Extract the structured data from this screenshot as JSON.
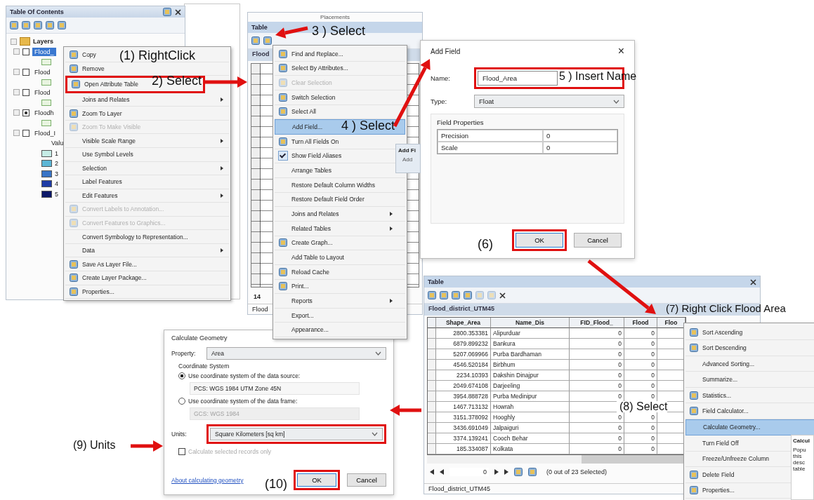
{
  "annotations": [
    "(1) RightClick",
    "2) Select",
    "3 ) Select",
    "4 ) Select",
    "5 ) Insert Name",
    "(6)",
    "(7) Right Click Flood Area",
    "(8) Select",
    "(9) Units",
    "(10)"
  ],
  "toc": {
    "title": "Table Of Contents",
    "root": "Layers",
    "layers": [
      {
        "label": "Flood_",
        "checked": false,
        "selected": true
      },
      {
        "label": "Flood",
        "checked": false,
        "selected": false
      },
      {
        "label": "Flood",
        "checked": false,
        "selected": false
      },
      {
        "label": "Floodh",
        "checked": true,
        "selected": false
      },
      {
        "label": "Flood_I",
        "checked": false,
        "selected": false,
        "legend_heading": "Valu",
        "legend": [
          {
            "label": "1",
            "color": "#c6ece6"
          },
          {
            "label": "2",
            "color": "#5cb6d6"
          },
          {
            "label": "3",
            "color": "#3a74c6"
          },
          {
            "label": "4",
            "color": "#1f3ca6"
          },
          {
            "label": "5",
            "color": "#0b1868"
          }
        ]
      }
    ]
  },
  "layer_menu": {
    "items": [
      {
        "label": "Copy",
        "icon": true,
        "disabled": false,
        "submenu": false,
        "outlined": false
      },
      {
        "label": "Remove",
        "icon": true,
        "disabled": false,
        "submenu": false,
        "outlined": false
      },
      {
        "label": "Open Attribute Table",
        "icon": true,
        "disabled": false,
        "submenu": false,
        "outlined": true
      },
      {
        "label": "Joins and Relates",
        "icon": false,
        "disabled": false,
        "submenu": true,
        "outlined": false
      },
      {
        "label": "Zoom To Layer",
        "icon": true,
        "disabled": false,
        "submenu": false,
        "outlined": false
      },
      {
        "label": "Zoom To Make Visible",
        "icon": true,
        "disabled": true,
        "submenu": false,
        "outlined": false
      },
      {
        "label": "Visible Scale Range",
        "icon": false,
        "disabled": false,
        "submenu": true,
        "outlined": false
      },
      {
        "label": "Use Symbol Levels",
        "icon": false,
        "disabled": false,
        "submenu": false,
        "outlined": false
      },
      {
        "label": "Selection",
        "icon": false,
        "disabled": false,
        "submenu": true,
        "outlined": false
      },
      {
        "label": "Label Features",
        "icon": false,
        "disabled": false,
        "submenu": false,
        "outlined": false
      },
      {
        "label": "Edit Features",
        "icon": false,
        "disabled": false,
        "submenu": true,
        "outlined": false
      },
      {
        "label": "Convert Labels to Annotation...",
        "icon": true,
        "disabled": true,
        "submenu": false,
        "outlined": false
      },
      {
        "label": "Convert Features to Graphics...",
        "icon": true,
        "disabled": true,
        "submenu": false,
        "outlined": false
      },
      {
        "label": "Convert Symbology to Representation...",
        "icon": false,
        "disabled": false,
        "submenu": false,
        "outlined": false
      },
      {
        "label": "Data",
        "icon": false,
        "disabled": false,
        "submenu": true,
        "outlined": false
      },
      {
        "label": "Save As Layer File...",
        "icon": true,
        "disabled": false,
        "submenu": false,
        "outlined": false
      },
      {
        "label": "Create Layer Package...",
        "icon": true,
        "disabled": false,
        "submenu": false,
        "outlined": false
      },
      {
        "label": "Properties...",
        "icon": true,
        "disabled": false,
        "submenu": false,
        "outlined": false
      }
    ]
  },
  "table_window": {
    "caption": "Placements",
    "title": "Table",
    "tab": "Flood",
    "nav_label": "14",
    "footer_tab": "Flood"
  },
  "table_menu": {
    "items": [
      {
        "label": "Find and Replace...",
        "icon": true,
        "disabled": false,
        "submenu": false,
        "selected": false,
        "checked": false
      },
      {
        "label": "Select By Attributes...",
        "icon": true,
        "disabled": false,
        "submenu": false,
        "selected": false,
        "checked": false
      },
      {
        "label": "Clear Selection",
        "icon": true,
        "disabled": true,
        "submenu": false,
        "selected": false,
        "checked": false
      },
      {
        "label": "Switch Selection",
        "icon": true,
        "disabled": false,
        "submenu": false,
        "selected": false,
        "checked": false
      },
      {
        "label": "Select All",
        "icon": true,
        "disabled": false,
        "submenu": false,
        "selected": false,
        "checked": false
      },
      {
        "label": "Add Field...",
        "icon": false,
        "disabled": false,
        "submenu": false,
        "selected": true,
        "checked": false
      },
      {
        "label": "Turn All Fields On",
        "icon": true,
        "disabled": false,
        "submenu": false,
        "selected": false,
        "checked": false
      },
      {
        "label": "Show Field Aliases",
        "icon": false,
        "disabled": false,
        "submenu": false,
        "selected": false,
        "checked": true
      },
      {
        "label": "Arrange Tables",
        "icon": false,
        "disabled": false,
        "submenu": false,
        "selected": false,
        "checked": false
      },
      {
        "label": "Restore Default Column Widths",
        "icon": false,
        "disabled": false,
        "submenu": false,
        "selected": false,
        "checked": false
      },
      {
        "label": "Restore Default Field Order",
        "icon": false,
        "disabled": false,
        "submenu": false,
        "selected": false,
        "checked": false
      },
      {
        "label": "Joins and Relates",
        "icon": false,
        "disabled": false,
        "submenu": true,
        "selected": false,
        "checked": false
      },
      {
        "label": "Related Tables",
        "icon": false,
        "disabled": false,
        "submenu": true,
        "selected": false,
        "checked": false
      },
      {
        "label": "Create Graph...",
        "icon": true,
        "disabled": false,
        "submenu": false,
        "selected": false,
        "checked": false
      },
      {
        "label": "Add Table to Layout",
        "icon": false,
        "disabled": false,
        "submenu": false,
        "selected": false,
        "checked": false
      },
      {
        "label": "Reload Cache",
        "icon": true,
        "disabled": false,
        "submenu": false,
        "selected": false,
        "checked": false
      },
      {
        "label": "Print...",
        "icon": true,
        "disabled": false,
        "submenu": false,
        "selected": false,
        "checked": false
      },
      {
        "label": "Reports",
        "icon": false,
        "disabled": false,
        "submenu": true,
        "selected": false,
        "checked": false
      },
      {
        "label": "Export...",
        "icon": false,
        "disabled": false,
        "submenu": false,
        "selected": false,
        "checked": false
      },
      {
        "label": "Appearance...",
        "icon": false,
        "disabled": false,
        "submenu": false,
        "selected": false,
        "checked": false
      }
    ]
  },
  "menu_tooltip": {
    "title": "Add Fi",
    "body": "Add"
  },
  "add_field": {
    "title": "Add Field",
    "close": "×",
    "name_label": "Name:",
    "name_value": "Flood_Area",
    "name_outlined": true,
    "type_label": "Type:",
    "type_value": "Float",
    "group_label": "Field Properties",
    "properties": [
      {
        "label": "Precision",
        "value": "0"
      },
      {
        "label": "Scale",
        "value": "0"
      }
    ],
    "buttons": [
      {
        "label": "OK",
        "outlined": true
      },
      {
        "label": "Cancel",
        "outlined": false
      }
    ]
  },
  "attribute_table": {
    "title": "Table",
    "tab": "Flood_district_UTM45",
    "columns": [
      {
        "label": "Shape_Area"
      },
      {
        "label": "Name_Dis"
      },
      {
        "label": "FID_Flood_"
      },
      {
        "label": "Flood"
      },
      {
        "label": "Floo"
      }
    ],
    "rows": [
      [
        "2800.353381",
        "Alipurduar",
        "0",
        "0"
      ],
      [
        "6879.899232",
        "Bankura",
        "0",
        "0"
      ],
      [
        "5207.069966",
        "Purba Bardhaman",
        "0",
        "0"
      ],
      [
        "4546.520184",
        "Birbhum",
        "0",
        "0"
      ],
      [
        "2234.10393",
        "Dakshin Dinajpur",
        "0",
        "0"
      ],
      [
        "2049.674108",
        "Darjeeling",
        "0",
        "0"
      ],
      [
        "3954.888728",
        "Purba Medinipur",
        "0",
        "0"
      ],
      [
        "1467.713132",
        "Howrah"
      ],
      [
        "3151.378092",
        "Hooghly",
        "0",
        "0"
      ],
      [
        "3436.691049",
        "Jalpaiguri",
        "0",
        "0"
      ],
      [
        "3374.139241",
        "Cooch Behar",
        "0",
        "0"
      ],
      [
        "185.334087",
        "Kolkata",
        "0",
        "0"
      ]
    ],
    "record": "0",
    "selection_status": "(0 out of 23 Selected)",
    "footer_tab": "Flood_district_UTM45"
  },
  "column_menu": {
    "items": [
      {
        "label": "Sort Ascending",
        "icon": true,
        "selected": false
      },
      {
        "label": "Sort Descending",
        "icon": true,
        "selected": false
      },
      {
        "label": "Advanced Sorting...",
        "icon": false,
        "selected": false
      },
      {
        "label": "Summarize...",
        "icon": false,
        "selected": false
      },
      {
        "label": "Statistics...",
        "icon": true,
        "selected": false
      },
      {
        "label": "Field Calculator...",
        "icon": true,
        "selected": false
      },
      {
        "label": "Calculate Geometry...",
        "icon": false,
        "selected": true
      },
      {
        "label": "Turn Field Off",
        "icon": false,
        "selected": false
      },
      {
        "label": "Freeze/Unfreeze Column",
        "icon": false,
        "selected": false
      },
      {
        "label": "Delete Field",
        "icon": true,
        "selected": false
      },
      {
        "label": "Properties...",
        "icon": true,
        "selected": false
      }
    ]
  },
  "column_tooltip": {
    "title": "Calcul",
    "body": [
      "Popu",
      "this",
      "desc",
      "table"
    ]
  },
  "calculate_geometry": {
    "title": "Calculate Geometry",
    "property_label": "Property:",
    "property_value": "Area",
    "group_label": "Coordinate System",
    "options": [
      {
        "label": "Use coordinate system of the data source:",
        "value": "PCS: WGS 1984 UTM Zone 45N",
        "selected": true,
        "disabled": false
      },
      {
        "label": "Use coordinate system of the data frame:",
        "value": "GCS: WGS 1984",
        "selected": false,
        "disabled": true
      }
    ],
    "units_label": "Units:",
    "units_value": "Square Kilometers [sq km]",
    "units_outlined": true,
    "selected_only": {
      "label": "Calculate selected records only",
      "checked": false,
      "disabled": true
    },
    "link": "About calculating geometry",
    "buttons": [
      {
        "label": "OK",
        "outlined": true
      },
      {
        "label": "Cancel",
        "outlined": false
      }
    ]
  }
}
